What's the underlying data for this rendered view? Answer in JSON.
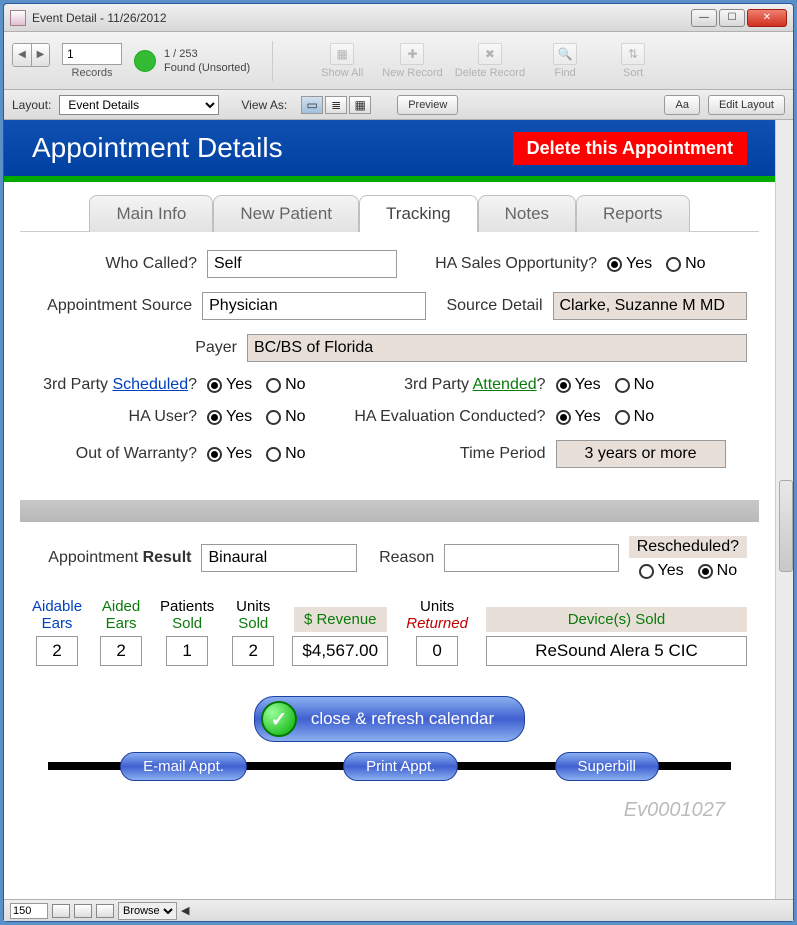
{
  "window": {
    "title": "Event Detail  -  11/26/2012"
  },
  "toolbar": {
    "record_number": "1",
    "records_label": "Records",
    "found_count": "1 / 253",
    "found_status": "Found (Unsorted)",
    "show_all": "Show All",
    "new_record": "New Record",
    "delete_record": "Delete Record",
    "find": "Find",
    "sort": "Sort"
  },
  "layoutbar": {
    "layout_label": "Layout:",
    "layout_value": "Event Details",
    "view_as_label": "View As:",
    "preview": "Preview",
    "aa": "Aa",
    "edit_layout": "Edit Layout"
  },
  "header": {
    "title": "Appointment Details",
    "delete_button": "Delete this Appointment"
  },
  "tabs": [
    "Main Info",
    "New Patient",
    "Tracking",
    "Notes",
    "Reports"
  ],
  "active_tab": 2,
  "form": {
    "who_called_label": "Who Called?",
    "who_called_value": "Self",
    "ha_sales_label": "HA Sales Opportunity?",
    "ha_sales_value": "Yes",
    "appt_source_label": "Appointment Source",
    "appt_source_value": "Physician",
    "source_detail_label": "Source Detail",
    "source_detail_value": "Clarke, Suzanne M MD",
    "payer_label": "Payer",
    "payer_value": "BC/BS of Florida",
    "third_party_scheduled_prefix": "3rd Party ",
    "third_party_scheduled_link": "Scheduled",
    "third_party_scheduled_value": "Yes",
    "third_party_attended_prefix": "3rd Party ",
    "third_party_attended_link": "Attended",
    "third_party_attended_value": "Yes",
    "ha_user_label": "HA User?",
    "ha_user_value": "Yes",
    "ha_eval_label": "HA Evaluation Conducted?",
    "ha_eval_value": "Yes",
    "out_of_warranty_label": "Out of Warranty?",
    "out_of_warranty_value": "Yes",
    "time_period_label": "Time Period",
    "time_period_value": "3 years or more",
    "radio_yes": "Yes",
    "radio_no": "No"
  },
  "result": {
    "appt_result_prefix": "Appointment ",
    "appt_result_bold": "Result",
    "appt_result_value": "Binaural",
    "reason_label": "Reason",
    "reason_value": "",
    "rescheduled_label": "Rescheduled?",
    "rescheduled_value": "No"
  },
  "stats": {
    "aidable_ears_label1": "Aidable",
    "aidable_ears_label2": "Ears",
    "aidable_ears_value": "2",
    "aided_ears_label1": "Aided",
    "aided_ears_label2": "Ears",
    "aided_ears_value": "2",
    "patients_sold_label1": "Patients",
    "patients_sold_label2": "Sold",
    "patients_sold_value": "1",
    "units_sold_label1": "Units",
    "units_sold_label2": "Sold",
    "units_sold_value": "2",
    "revenue_label": "$ Revenue",
    "revenue_value": "$4,567.00",
    "units_returned_label1": "Units",
    "units_returned_label2": "Returned",
    "units_returned_value": "0",
    "devices_sold_label": "Device(s) Sold",
    "devices_sold_value": "ReSound Alera 5 CIC"
  },
  "buttons": {
    "close_refresh": "close & refresh calendar",
    "email_appt": "E-mail Appt.",
    "print_appt": "Print Appt.",
    "superbill": "Superbill"
  },
  "event_id": "Ev0001027",
  "statusbar": {
    "zoom": "150",
    "mode": "Browse"
  }
}
